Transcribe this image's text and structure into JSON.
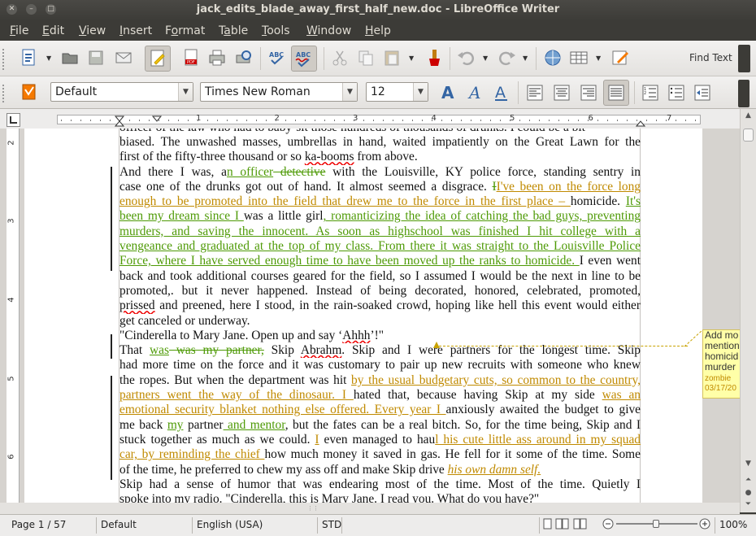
{
  "window": {
    "title": "jack_edits_blade_away_first_half_new.doc - LibreOffice Writer"
  },
  "menu": [
    {
      "label": "File",
      "u": "F",
      "rest": "ile"
    },
    {
      "label": "Edit",
      "u": "E",
      "rest": "dit"
    },
    {
      "label": "View",
      "u": "V",
      "rest": "iew"
    },
    {
      "label": "Insert",
      "u": "I",
      "rest": "nsert"
    },
    {
      "label": "Format",
      "u": "o",
      "pre": "F",
      "rest": "rmat"
    },
    {
      "label": "Table",
      "u": "a",
      "pre": "T",
      "rest": "ble"
    },
    {
      "label": "Tools",
      "u": "T",
      "rest": "ools"
    },
    {
      "label": "Window",
      "u": "W",
      "rest": "indow"
    },
    {
      "label": "Help",
      "u": "H",
      "rest": "elp"
    }
  ],
  "toolbar": {
    "find_text": "Find Text",
    "paragraph_style": "Default",
    "font_name": "Times New Roman",
    "font_size": "12"
  },
  "ruler": {
    "h_numbers": [
      "1",
      "2",
      "3",
      "4",
      "5",
      "6",
      "7"
    ],
    "v_numbers": [
      "2",
      "3",
      "4",
      "5",
      "6"
    ]
  },
  "document": {
    "lines": [
      [
        {
          "t": "biased.  The unwashed masses, umbrellas in hand, waited impatiently on the Great Lawn for the"
        }
      ],
      [
        {
          "t": "first of the fifty-three thousand or so "
        },
        {
          "t": "ka-booms",
          "s": "sq"
        },
        {
          "t": " from above."
        }
      ],
      [
        {
          "t": "          And there I was, a"
        },
        {
          "t": "n officer",
          "s": "ins-g"
        },
        {
          "t": " detective",
          "s": "del-g"
        },
        {
          "t": " with the Louisville, KY police force, standing sentry in"
        }
      ],
      [
        {
          "t": "case one of the drunks got out of hand.  It almost seemed a disgrace.  "
        },
        {
          "t": "I",
          "s": "del-g"
        },
        {
          "t": "I've been on the force long",
          "s": "ins-o"
        }
      ],
      [
        {
          "t": "enough to be promoted  into  the field that drew me to the force in the first place – ",
          "s": "ins-o"
        },
        {
          "t": "homicide. "
        },
        {
          "t": "It's",
          "s": "ins-g"
        }
      ],
      [
        {
          "t": "been my dream since I ",
          "s": "ins-g"
        },
        {
          "t": "was a little girl"
        },
        {
          "t": ", romanticizing the idea of catching the bad guys, preventing",
          "s": "ins-g"
        }
      ],
      [
        {
          "t": "murders,  and  saving  the  innocent.  As soon  as  highschool  was  finished  I  hit  college  with  a",
          "s": "ins-g"
        }
      ],
      [
        {
          "t": "vengeance and graduated at the top of my class. From there it was straight to the Louisville Police",
          "s": "ins-g"
        }
      ],
      [
        {
          "t": "Force, where I have served enough time to have been moved up the ranks to homicide.  ",
          "s": "ins-g"
        },
        {
          "t": " I even went"
        }
      ],
      [
        {
          "t": "back and took additional courses geared for the field, so I assumed I would be the next in line to be"
        }
      ],
      [
        {
          "t": "promoted,.  but  it  never  happened.  Instead  of  being  decorated,  honored,  celebrated,  promoted,"
        }
      ],
      [
        {
          "t": "prissed",
          "s": "sq"
        },
        {
          "t": " and preened, here I stood, in the rain-soaked crowd, hoping like hell this event would either"
        }
      ],
      [
        {
          "t": "get canceled or underway."
        }
      ],
      [
        {
          "t": "          \"Cinderella to Mary Jane. Open up and say ‘"
        },
        {
          "t": "Ahhh",
          "s": "sq"
        },
        {
          "t": "’!\""
        }
      ],
      [
        {
          "t": "          That "
        },
        {
          "t": "was",
          "s": "ins-g"
        },
        {
          "t": " was my partner,",
          "s": "del-g"
        },
        {
          "t": " Skip "
        },
        {
          "t": "Abrahm",
          "s": "sq"
        },
        {
          "t": ". Skip and I were partners for the longest time. Skip"
        }
      ],
      [
        {
          "t": "had more time on the force and it was customary to pair up new recruits with someone who knew"
        }
      ],
      [
        {
          "t": "the ropes. But when the department was hit "
        },
        {
          "t": "by the usual budgetary cuts, so common to the country,",
          "s": "ins-o"
        }
      ],
      [
        {
          "t": "partners  went  the  way  of  the  dinosaur.  I ",
          "s": "ins-o"
        },
        {
          "t": "hated  that,  because  having  Skip  at  my  side  "
        },
        {
          "t": "was  an",
          "s": "ins-o"
        }
      ],
      [
        {
          "t": "emotional security blanket nothing else offered. Every year I ",
          "s": "ins-o"
        },
        {
          "t": "anxiously awaited the budget to give"
        }
      ],
      [
        {
          "t": "me back "
        },
        {
          "t": "my",
          "s": "ins-g"
        },
        {
          "t": " partner"
        },
        {
          "t": " and mentor",
          "s": "ins-g"
        },
        {
          "t": ", but the fates can be a real bitch. So, for the time being, Skip and I"
        }
      ],
      [
        {
          "t": "stuck together as much as we could. "
        },
        {
          "t": "I",
          "s": "ins-o"
        },
        {
          "t": " even managed to hau"
        },
        {
          "t": "l his cute little ass around in my squad",
          "s": "ins-o"
        }
      ],
      [
        {
          "t": "car, by reminding the chief ",
          "s": "ins-o"
        },
        {
          "t": "how much money it saved in gas. He fell for it some of the time. Some"
        }
      ],
      [
        {
          "t": "of the time, he preferred to chew my ass off and make Skip drive "
        },
        {
          "t": "his own damn self.",
          "s": "ins-o it"
        }
      ],
      [
        {
          "t": "          Skip had a sense of humor that was endearing most of the time. Most of the time. Quietly I"
        }
      ],
      [
        {
          "t": "spoke into my radio. \"Cinderella, this is Mary Jane. I read you. What do you have?\""
        }
      ]
    ]
  },
  "comment": {
    "text_lines": [
      "Add mo",
      "mention",
      "homicid",
      "murder"
    ],
    "author": "zombie",
    "date": "03/17/20"
  },
  "status": {
    "page": "Page 1 / 57",
    "style": "Default",
    "language": "English (USA)",
    "mode": "STD",
    "zoom": "100%"
  }
}
